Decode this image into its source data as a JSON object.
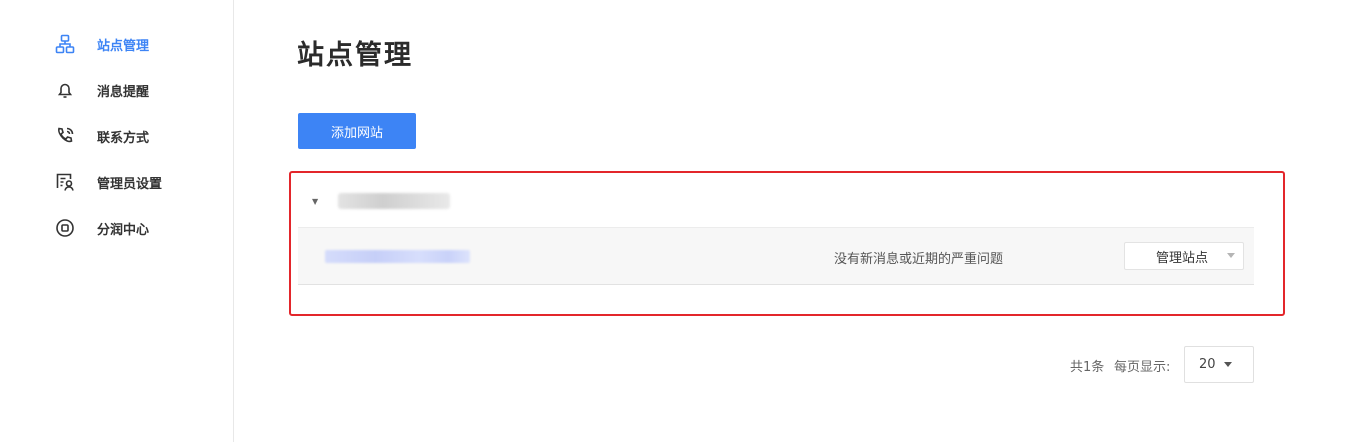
{
  "sidebar": {
    "items": [
      {
        "label": "站点管理",
        "icon": "sitemap-icon",
        "active": true
      },
      {
        "label": "消息提醒",
        "icon": "bell-icon",
        "active": false
      },
      {
        "label": "联系方式",
        "icon": "phone-icon",
        "active": false
      },
      {
        "label": "管理员设置",
        "icon": "admin-badge-icon",
        "active": false
      },
      {
        "label": "分润中心",
        "icon": "revenue-coin-icon",
        "active": false
      }
    ]
  },
  "main": {
    "title": "站点管理",
    "add_site_label": "添加网站",
    "site_group": {
      "toggle_icon": "caret-down-icon",
      "sites": [
        {
          "status": "没有新消息或近期的严重问题",
          "manage_label": "管理站点"
        }
      ]
    }
  },
  "pagination": {
    "total": "共1条",
    "per_page_label": "每页显示:",
    "page_size": "20"
  },
  "colors": {
    "accent": "#3d84f5",
    "highlight_frame": "#e3262b",
    "row_background": "#f7f7f7"
  }
}
